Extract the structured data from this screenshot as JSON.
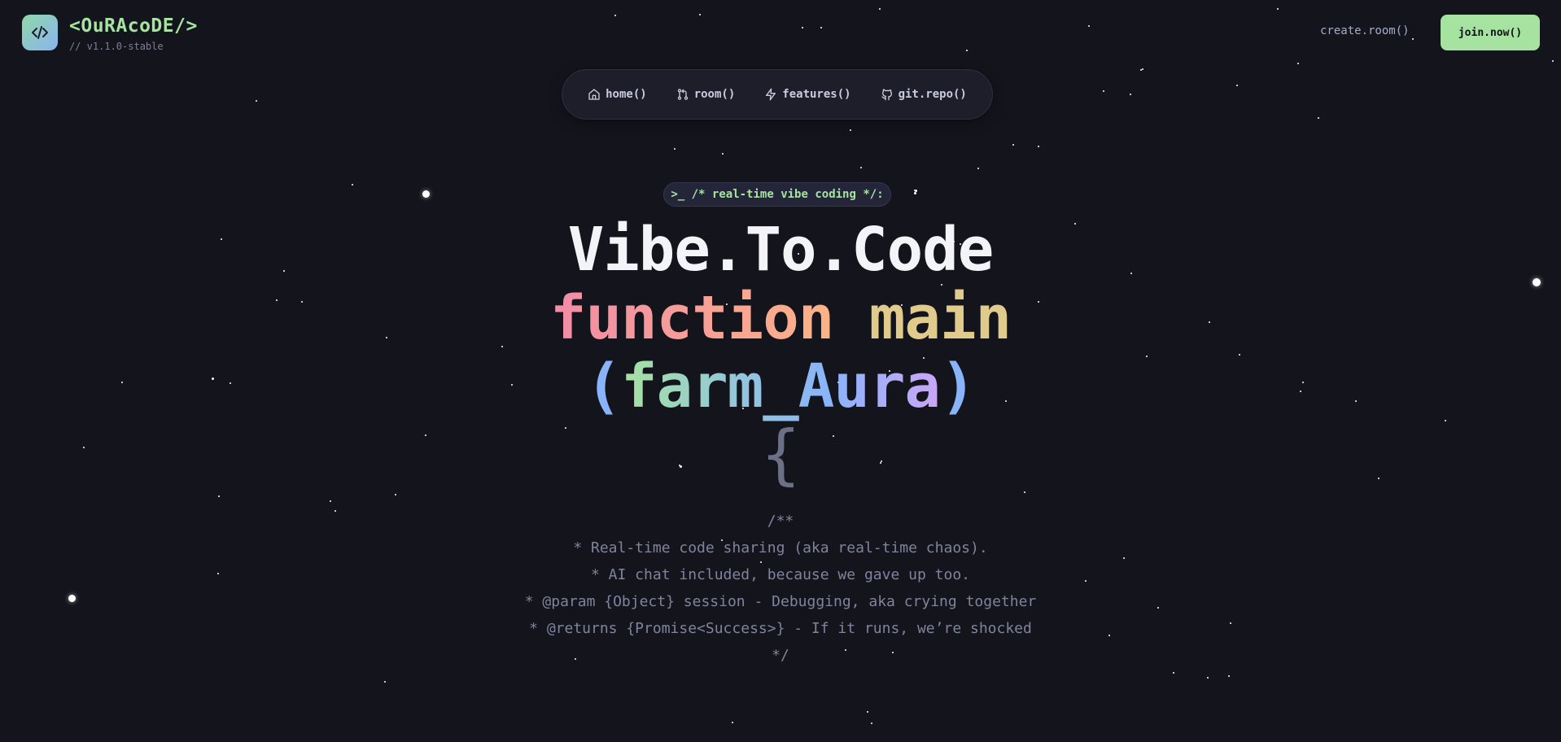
{
  "header": {
    "logo_icon": "code-icon",
    "brand": "<OuRAcoDE/>",
    "version": "// v1.1.0-stable",
    "create_room": "create.room()",
    "join_now": "join.now()"
  },
  "nav": {
    "items": [
      {
        "label": "home()",
        "icon": "home-icon"
      },
      {
        "label": "room()",
        "icon": "git-pull-request-icon"
      },
      {
        "label": "features()",
        "icon": "lightning-icon"
      },
      {
        "label": "git.repo()",
        "icon": "github-icon"
      }
    ]
  },
  "hero": {
    "tag": ">_ /* real-time vibe coding */:",
    "title": "Vibe.To.Code",
    "line2_keyword": "function",
    "line2_name": "main",
    "line3_open": "(",
    "line3_param": "farm_Aura",
    "line3_close": ")",
    "line4": "{"
  },
  "doc_comment": {
    "lines": [
      "/**",
      "* Real-time code sharing (aka real-time chaos).",
      "* AI chat included, because we gave up too.",
      "* @param {Object} session - Debugging, aka crying together",
      "* @returns {Promise<Success>} - If it runs, we’re shocked",
      "*/"
    ]
  },
  "colors": {
    "background": "#14141d",
    "accent_green": "#a6e3a1",
    "accent_blue": "#89b4fa",
    "accent_purple": "#cba6f7",
    "accent_pink": "#f38ba8",
    "accent_yellow": "#e0cb8c",
    "muted": "#7f849c"
  }
}
